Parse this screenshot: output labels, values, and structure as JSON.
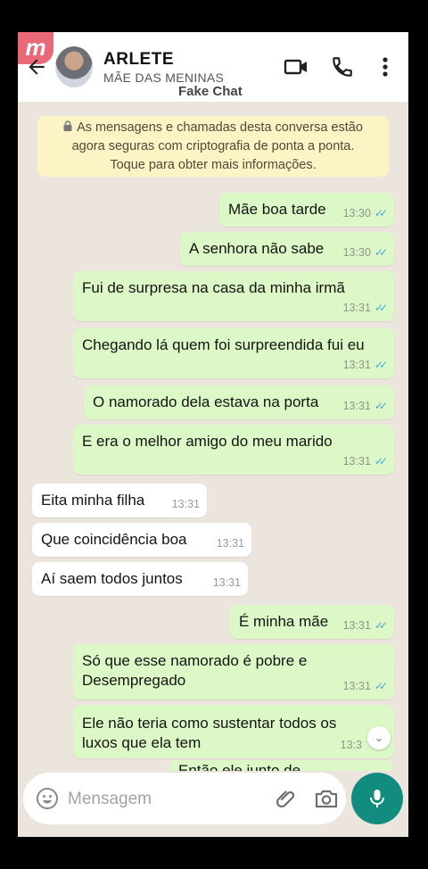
{
  "header": {
    "logo_text": "m",
    "contact_name": "ARLETE",
    "contact_subtitle": "MÃE DAS MENINAS",
    "watermark": "Fake Chat",
    "icons": [
      "back-arrow-icon",
      "video-call-icon",
      "phone-icon",
      "more-vert-icon"
    ]
  },
  "notice": {
    "lock_icon": "lock-icon",
    "line1": "As mensagens e chamadas desta conversa estão",
    "line2": "agora seguras com criptografia de ponta a ponta.",
    "line3": "Toque para obter mais informações."
  },
  "messages": [
    {
      "dir": "out",
      "text": "Mãe boa tarde",
      "time": "13:30",
      "status": "read"
    },
    {
      "dir": "out",
      "text": "A senhora não sabe",
      "time": "13:30",
      "status": "read"
    },
    {
      "dir": "out",
      "text": "Fui de surpresa na casa da minha irmã",
      "time": "13:31",
      "status": "read"
    },
    {
      "dir": "out",
      "text": "Chegando lá quem foi surpreendida fui eu",
      "time": "13:31",
      "status": "read"
    },
    {
      "dir": "out",
      "text": "O namorado dela estava na porta",
      "time": "13:31",
      "status": "read"
    },
    {
      "dir": "out",
      "text": "E era o melhor amigo do meu marido",
      "time": "13:31",
      "status": "read"
    },
    {
      "dir": "in",
      "text": "Eita minha filha",
      "time": "13:31"
    },
    {
      "dir": "in",
      "text": "Que coincidência boa",
      "time": "13:31"
    },
    {
      "dir": "in",
      "text": "Aí saem todos juntos",
      "time": "13:31"
    },
    {
      "dir": "out",
      "text": "É minha mãe",
      "time": "13:31",
      "status": "read"
    },
    {
      "dir": "out",
      "line1": "Só que esse namorado é pobre e",
      "line2": "Desempregado",
      "time": "13:31",
      "status": "read"
    },
    {
      "dir": "out",
      "line1": "Ele não teria como sustentar todos os",
      "line2": "luxos que ela tem",
      "time": "13:3",
      "status": "read"
    },
    {
      "dir": "out",
      "text": "Então ele junto de",
      "time": ""
    }
  ],
  "footer": {
    "placeholder": "Mensagem",
    "icons": [
      "emoji-icon",
      "attach-icon",
      "camera-icon",
      "mic-icon"
    ]
  },
  "colors": {
    "outgoing_bubble": "#dcf8c6",
    "incoming_bubble": "#ffffff",
    "notice_bg": "#fdf4c5",
    "accent": "#128c7e",
    "read_tick": "#4fa5e0"
  }
}
